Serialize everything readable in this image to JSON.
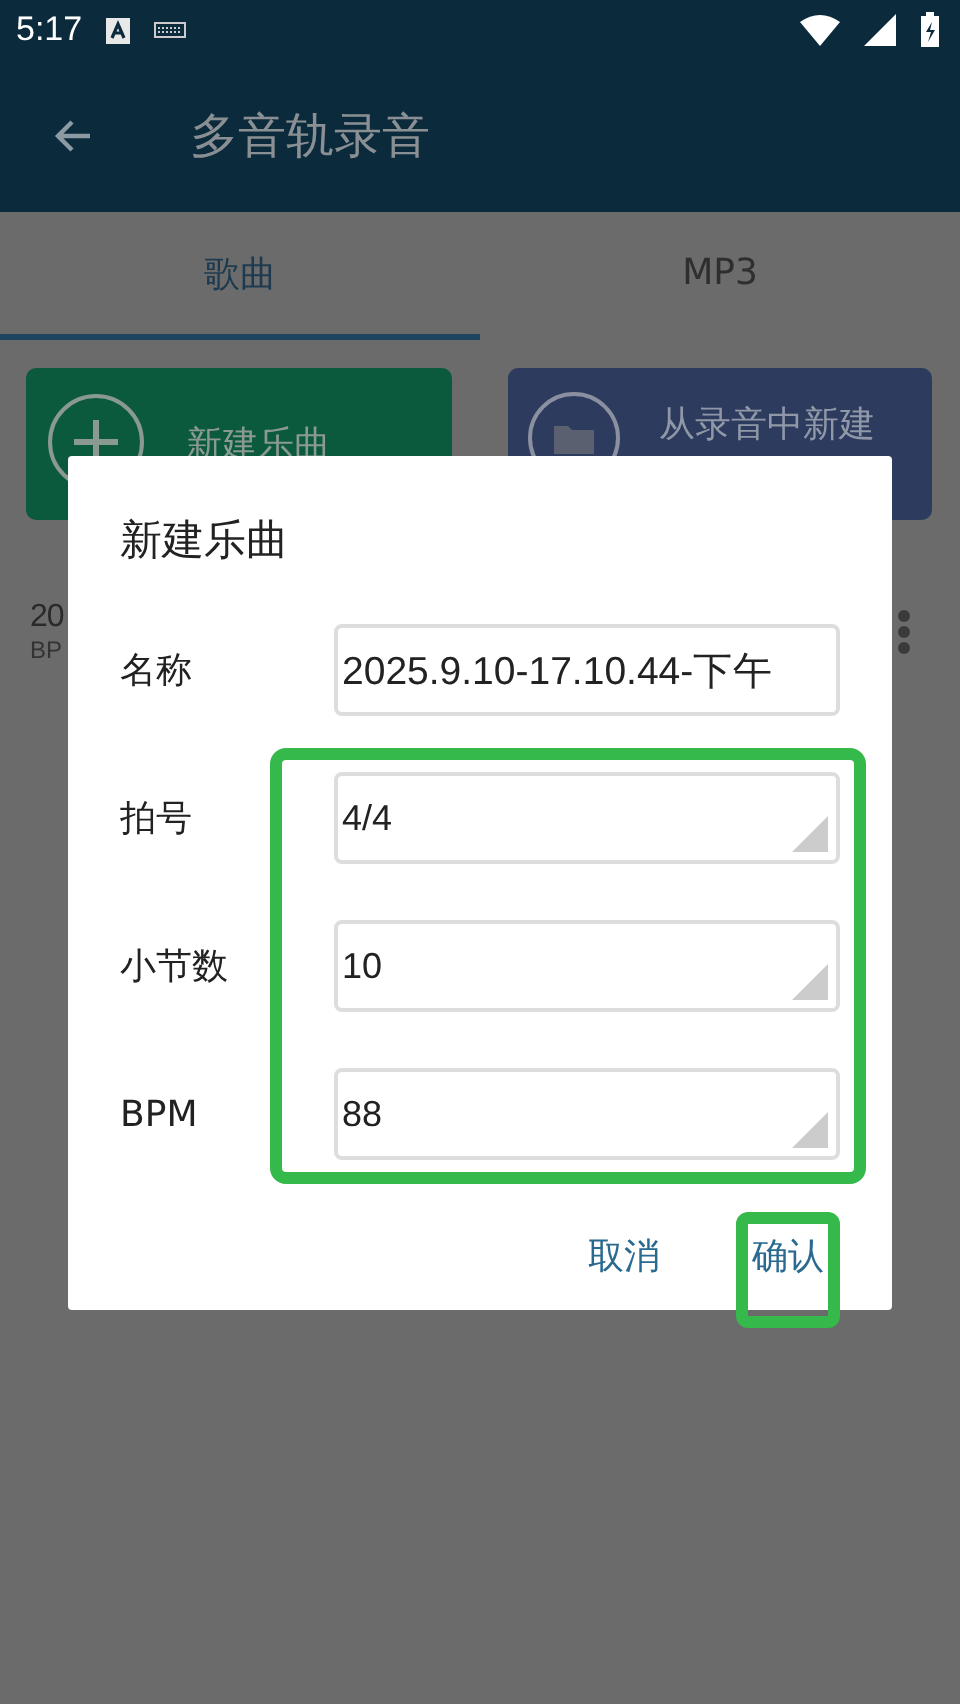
{
  "status_bar": {
    "time": "5:17"
  },
  "app_bar": {
    "title": "多音轨录音"
  },
  "tabs": [
    {
      "label": "歌曲",
      "selected": true
    },
    {
      "label": "MP3",
      "selected": false
    }
  ],
  "actions": [
    {
      "label": "新建乐曲",
      "kind": "new"
    },
    {
      "label": "从录音中新建",
      "kind": "import"
    }
  ],
  "songs": [
    {
      "title": "20",
      "subtitle": "BP"
    }
  ],
  "dialog": {
    "title": "新建乐曲",
    "select_fields_highlighted": true,
    "fields": [
      {
        "label": "名称",
        "value": "2025.9.10-17.10.44-下午",
        "kind": "text"
      },
      {
        "label": "拍号",
        "value": "4/4",
        "kind": "select"
      },
      {
        "label": "小节数",
        "value": "10",
        "kind": "select"
      },
      {
        "label": "BPM",
        "value": "88",
        "kind": "select"
      }
    ],
    "buttons": [
      {
        "label": "取消",
        "highlighted": false
      },
      {
        "label": "确认",
        "highlighted": true
      }
    ]
  }
}
